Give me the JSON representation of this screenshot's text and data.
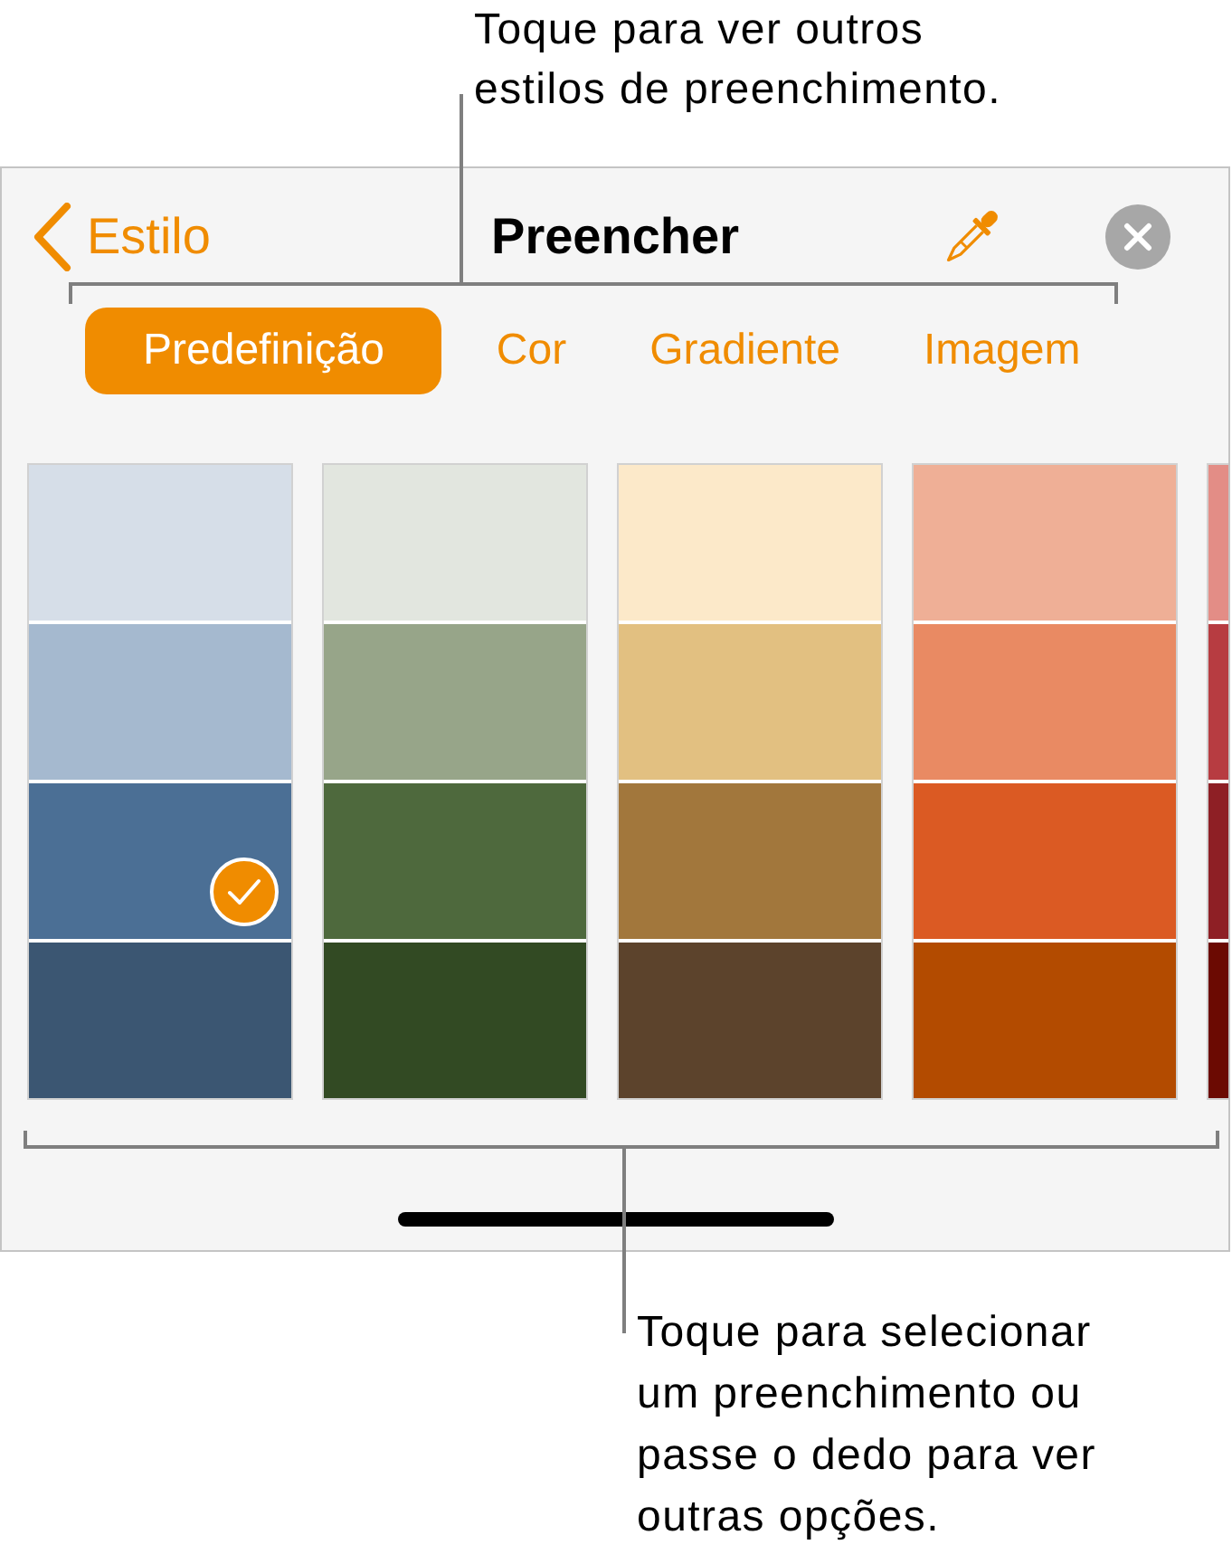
{
  "callout_top": "Toque para ver outros estilos de preenchimento.",
  "header": {
    "back_label": "Estilo",
    "title": "Preencher"
  },
  "tabs": [
    {
      "label": "Predefinição",
      "selected": true
    },
    {
      "label": "Cor",
      "selected": false
    },
    {
      "label": "Gradiente",
      "selected": false
    },
    {
      "label": "Imagem",
      "selected": false
    }
  ],
  "swatch_columns": [
    {
      "swatches": [
        {
          "color": "#d6dee8",
          "selected": false
        },
        {
          "color": "#a5b9cf",
          "selected": false
        },
        {
          "color": "#4b6f95",
          "selected": true
        },
        {
          "color": "#3b5672",
          "selected": false
        }
      ]
    },
    {
      "swatches": [
        {
          "color": "#e2e6df",
          "selected": false
        },
        {
          "color": "#97a589",
          "selected": false
        },
        {
          "color": "#4e693d",
          "selected": false
        },
        {
          "color": "#324a23",
          "selected": false
        }
      ]
    },
    {
      "swatches": [
        {
          "color": "#fce9c9",
          "selected": false
        },
        {
          "color": "#e2c081",
          "selected": false
        },
        {
          "color": "#a2773c",
          "selected": false
        },
        {
          "color": "#5c432c",
          "selected": false
        }
      ]
    },
    {
      "swatches": [
        {
          "color": "#efaf96",
          "selected": false
        },
        {
          "color": "#e98a63",
          "selected": false
        },
        {
          "color": "#db5a23",
          "selected": false
        },
        {
          "color": "#b34b00",
          "selected": false
        }
      ]
    },
    {
      "swatches": [
        {
          "color": "#e38d86",
          "selected": false
        },
        {
          "color": "#b73c41",
          "selected": false
        },
        {
          "color": "#8e1f25",
          "selected": false
        },
        {
          "color": "#6b0a02",
          "selected": false
        }
      ]
    }
  ],
  "callout_bottom": "Toque para selecionar um preenchimento ou passe o dedo para ver outras opções."
}
